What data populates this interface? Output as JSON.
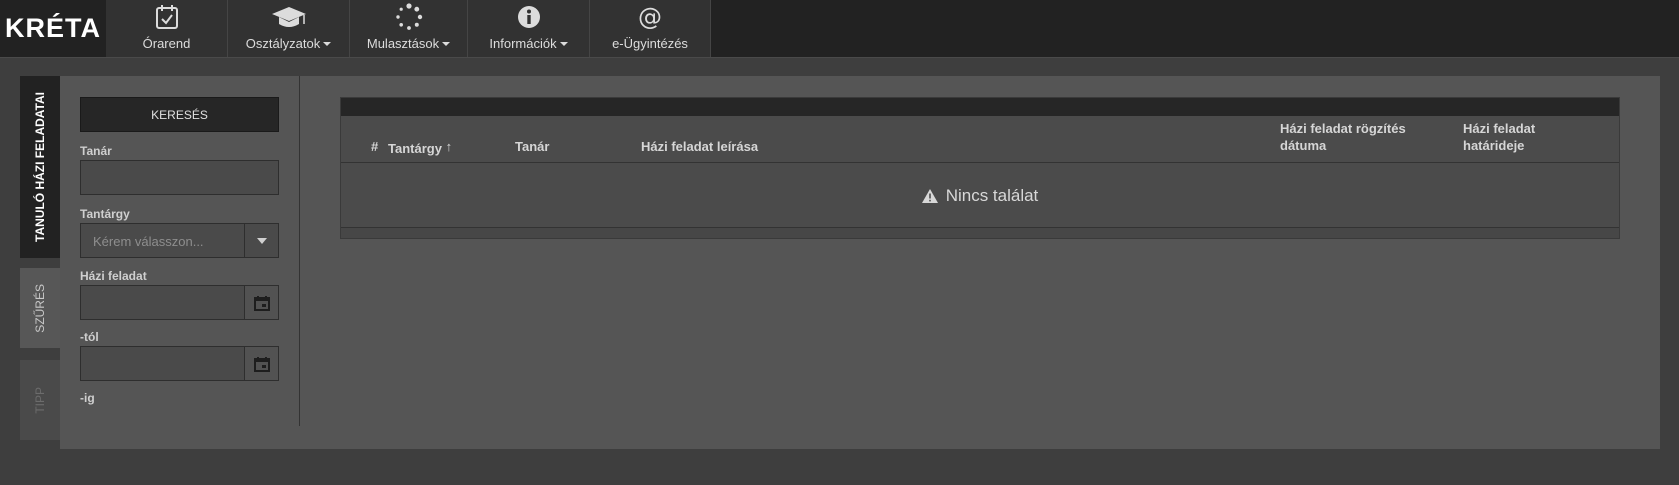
{
  "app": {
    "logo": "KRÉTA"
  },
  "nav": [
    {
      "label": "Órarend",
      "dropdown": false,
      "icon": "calendar-check-icon"
    },
    {
      "label": "Osztályzatok",
      "dropdown": true,
      "icon": "graduation-cap-icon"
    },
    {
      "label": "Mulasztások",
      "dropdown": true,
      "icon": "spinner-icon"
    },
    {
      "label": "Információk",
      "dropdown": true,
      "icon": "info-icon"
    },
    {
      "label": "e-Ügyintézés",
      "dropdown": false,
      "icon": "at-icon"
    }
  ],
  "side_tabs": {
    "active": "TANULÓ HÁZI FELADATAI",
    "filter": "SZŰRÉS",
    "tip": "TIPP"
  },
  "filter": {
    "search_button": "KERESÉS",
    "teacher_label": "Tanár",
    "teacher_value": "",
    "subject_label": "Tantárgy",
    "subject_placeholder": "Kérem válasszon...",
    "homework_label": "Házi feladat",
    "from_label": "-tól",
    "to_label": "-ig"
  },
  "grid": {
    "columns": {
      "number": "#",
      "subject": "Tantárgy",
      "teacher": "Tanár",
      "description": "Házi feladat leírása",
      "recorded_1": "Házi feladat rögzítés",
      "recorded_2": "dátuma",
      "deadline_1": "Házi feladat",
      "deadline_2": "határideje"
    },
    "empty_message": "Nincs találat"
  },
  "colors": {
    "topbar": "#222222",
    "nav_item": "#323232",
    "panel": "#555555",
    "page_bg": "#3e3e3e"
  }
}
